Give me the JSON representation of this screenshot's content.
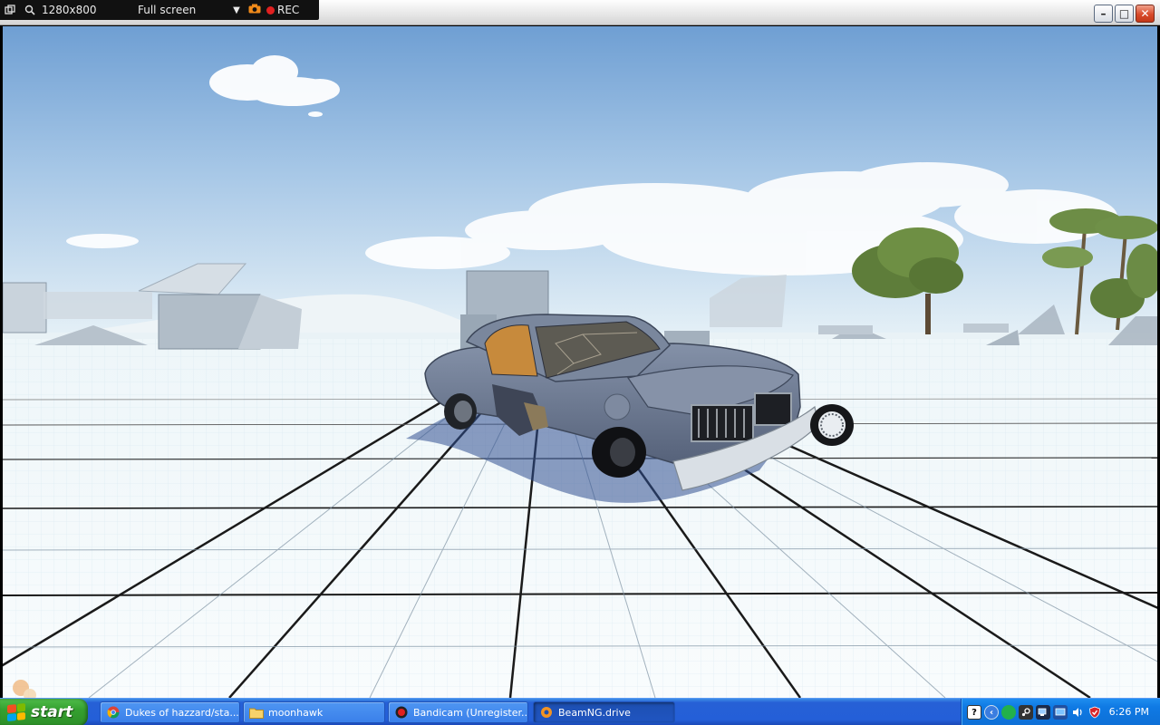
{
  "bandicam": {
    "resolution": "1280x800",
    "mode": "Full screen",
    "rec_label": "REC",
    "colors": {
      "rec": "#e02020",
      "camera": "#f08a1a"
    }
  },
  "window": {
    "minimize_glyph": "–",
    "maximize_glyph": "□",
    "close_glyph": "✕"
  },
  "taskbar": {
    "start_label": "start",
    "tasks": [
      {
        "label": "Dukes of hazzard/sta...",
        "icon": "chrome-icon"
      },
      {
        "label": "moonhawk",
        "icon": "folder-icon"
      },
      {
        "label": "Bandicam (Unregister...",
        "icon": "bandicam-icon"
      },
      {
        "label": "BeamNG.drive",
        "icon": "beamng-icon",
        "active": true
      }
    ],
    "tray": {
      "help_glyph": "?",
      "expand_glyph": "‹",
      "clock": "6:26 PM"
    }
  },
  "colors": {
    "sky_top": "#7aa8d8",
    "ground": "#f2f8fa",
    "car_body": "#6b7a93",
    "taskbar": "#245fd8",
    "start": "#35a030"
  }
}
